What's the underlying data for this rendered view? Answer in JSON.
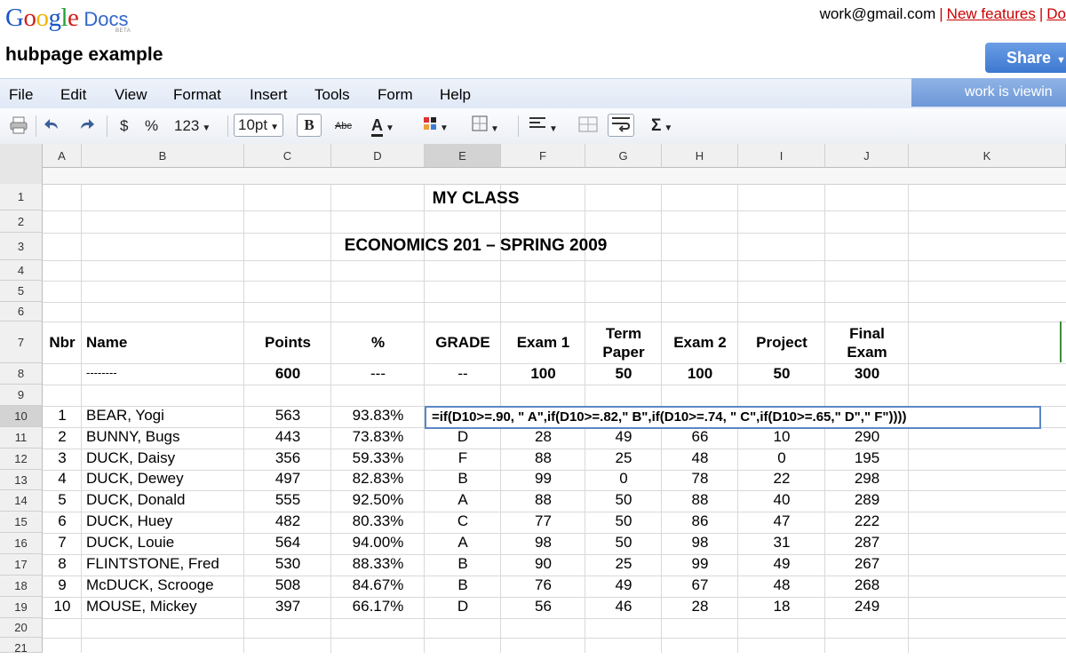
{
  "header": {
    "logo_google": "Google",
    "logo_docs": "Docs",
    "logo_beta": "BETA",
    "user_email": "work@gmail.com",
    "new_features": "New features",
    "docs_link": "Do",
    "doc_title": "hubpage example",
    "share_label": "Share",
    "viewing_text": "work is viewin"
  },
  "menu": [
    "File",
    "Edit",
    "View",
    "Format",
    "Insert",
    "Tools",
    "Form",
    "Help"
  ],
  "toolbar": {
    "currency": "$",
    "percent": "%",
    "number_format": "123",
    "font_size": "10pt",
    "bold": "B",
    "strike": "Abc",
    "text_color": "A",
    "sum": "Σ"
  },
  "columns": [
    "A",
    "B",
    "C",
    "D",
    "E",
    "F",
    "G",
    "H",
    "I",
    "J",
    "K"
  ],
  "rows": [
    "1",
    "2",
    "3",
    "4",
    "5",
    "6",
    "7",
    "8",
    "9",
    "10",
    "11",
    "12",
    "13",
    "14",
    "15",
    "16",
    "17",
    "18",
    "19",
    "20",
    "21"
  ],
  "sheet": {
    "title1": "MY CLASS",
    "title2": "ECONOMICS 201 – SPRING 2009",
    "headers": {
      "nbr": "Nbr",
      "name": "Name",
      "points": "Points",
      "pct": "%",
      "grade": "GRADE",
      "exam1": "Exam 1",
      "term_paper_1": "Term",
      "term_paper_2": "Paper",
      "exam2": "Exam 2",
      "project": "Project",
      "final_1": "Final",
      "final_2": "Exam"
    },
    "maxrow": {
      "name": "--------",
      "points": "600",
      "pct": "---",
      "grade": "--",
      "exam1": "100",
      "term": "50",
      "exam2": "100",
      "project": "50",
      "final": "300"
    },
    "students": [
      {
        "nbr": "1",
        "name": "BEAR, Yogi",
        "points": "563",
        "pct": "93.83%",
        "grade": "",
        "exam1": "",
        "term": "",
        "exam2": "",
        "project": "",
        "final": ""
      },
      {
        "nbr": "2",
        "name": "BUNNY, Bugs",
        "points": "443",
        "pct": "73.83%",
        "grade": "D",
        "exam1": "28",
        "term": "49",
        "exam2": "66",
        "project": "10",
        "final": "290"
      },
      {
        "nbr": "3",
        "name": "DUCK, Daisy",
        "points": "356",
        "pct": "59.33%",
        "grade": "F",
        "exam1": "88",
        "term": "25",
        "exam2": "48",
        "project": "0",
        "final": "195"
      },
      {
        "nbr": "4",
        "name": "DUCK, Dewey",
        "points": "497",
        "pct": "82.83%",
        "grade": "B",
        "exam1": "99",
        "term": "0",
        "exam2": "78",
        "project": "22",
        "final": "298"
      },
      {
        "nbr": "5",
        "name": "DUCK, Donald",
        "points": "555",
        "pct": "92.50%",
        "grade": "A",
        "exam1": "88",
        "term": "50",
        "exam2": "88",
        "project": "40",
        "final": "289"
      },
      {
        "nbr": "6",
        "name": "DUCK, Huey",
        "points": "482",
        "pct": "80.33%",
        "grade": "C",
        "exam1": "77",
        "term": "50",
        "exam2": "86",
        "project": "47",
        "final": "222"
      },
      {
        "nbr": "7",
        "name": "DUCK, Louie",
        "points": "564",
        "pct": "94.00%",
        "grade": "A",
        "exam1": "98",
        "term": "50",
        "exam2": "98",
        "project": "31",
        "final": "287"
      },
      {
        "nbr": "8",
        "name": "FLINTSTONE, Fred",
        "points": "530",
        "pct": "88.33%",
        "grade": "B",
        "exam1": "90",
        "term": "25",
        "exam2": "99",
        "project": "49",
        "final": "267"
      },
      {
        "nbr": "9",
        "name": "McDUCK, Scrooge",
        "points": "508",
        "pct": "84.67%",
        "grade": "B",
        "exam1": "76",
        "term": "49",
        "exam2": "67",
        "project": "48",
        "final": "268"
      },
      {
        "nbr": "10",
        "name": "MOUSE, Mickey",
        "points": "397",
        "pct": "66.17%",
        "grade": "D",
        "exam1": "56",
        "term": "46",
        "exam2": "28",
        "project": "18",
        "final": "249"
      }
    ],
    "formula": "=if(D10>=.90, \" A\",if(D10>=.82,\" B\",if(D10>=.74, \" C\",if(D10>=.65,\" D\",\" F\"))))"
  }
}
